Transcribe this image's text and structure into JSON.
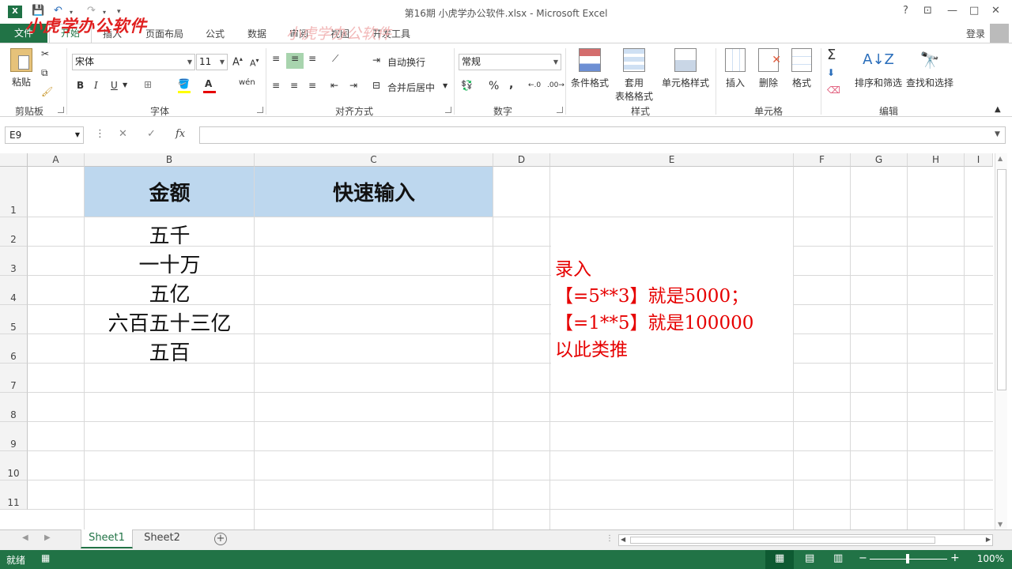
{
  "window": {
    "title": "第16期  小虎学办公软件.xlsx - Microsoft Excel",
    "help": "?",
    "watermark_logo": "小虎学办公软件",
    "watermark_center": "小虎学办公软件"
  },
  "tabs": {
    "file": "文件",
    "home": "开始",
    "insert": "插入",
    "page_layout": "页面布局",
    "formulas": "公式",
    "data": "数据",
    "review": "审阅",
    "view": "视图",
    "developer": "开发工具",
    "login": "登录"
  },
  "ribbon": {
    "clipboard": {
      "paste": "粘贴",
      "group": "剪贴板"
    },
    "font": {
      "name": "宋体",
      "size": "11",
      "group": "字体",
      "bold": "B",
      "italic": "I",
      "underline": "U"
    },
    "alignment": {
      "wrap": "自动换行",
      "merge": "合并后居中",
      "group": "对齐方式"
    },
    "number": {
      "format": "常规",
      "percent": "%",
      "comma": ",",
      "group": "数字"
    },
    "styles": {
      "conditional": "条件格式",
      "table_line1": "套用",
      "table_line2": "表格格式",
      "cell_styles": "单元格样式",
      "group": "样式"
    },
    "cells": {
      "insert": "插入",
      "delete": "删除",
      "format": "格式",
      "group": "单元格"
    },
    "editing": {
      "sort": "排序和筛选",
      "find": "查找和选择",
      "group": "编辑"
    }
  },
  "formula_bar": {
    "name_box": "E9",
    "fx": "fx",
    "value": ""
  },
  "columns": [
    "A",
    "B",
    "C",
    "D",
    "E",
    "F",
    "G",
    "H",
    "I"
  ],
  "rows": [
    "1",
    "2",
    "3",
    "4",
    "5",
    "6",
    "7",
    "8",
    "9",
    "10",
    "11"
  ],
  "cells": {
    "B1": "金额",
    "C1": "快速输入",
    "B2": "五千",
    "B3": "一十万",
    "B4": "五亿",
    "B5": "六百五十三亿",
    "B6": "五百"
  },
  "note": {
    "line1": "录入",
    "line2": "【=5**3】就是5000；",
    "line3": "【=1**5】就是100000",
    "line4": "以此类推"
  },
  "sheets": [
    "Sheet1",
    "Sheet2"
  ],
  "active_sheet": "Sheet1",
  "status": {
    "ready": "就绪",
    "zoom": "100%"
  },
  "colors": {
    "excel_green": "#217346",
    "header_fill": "#bdd7ee",
    "note_red": "#e60000"
  }
}
